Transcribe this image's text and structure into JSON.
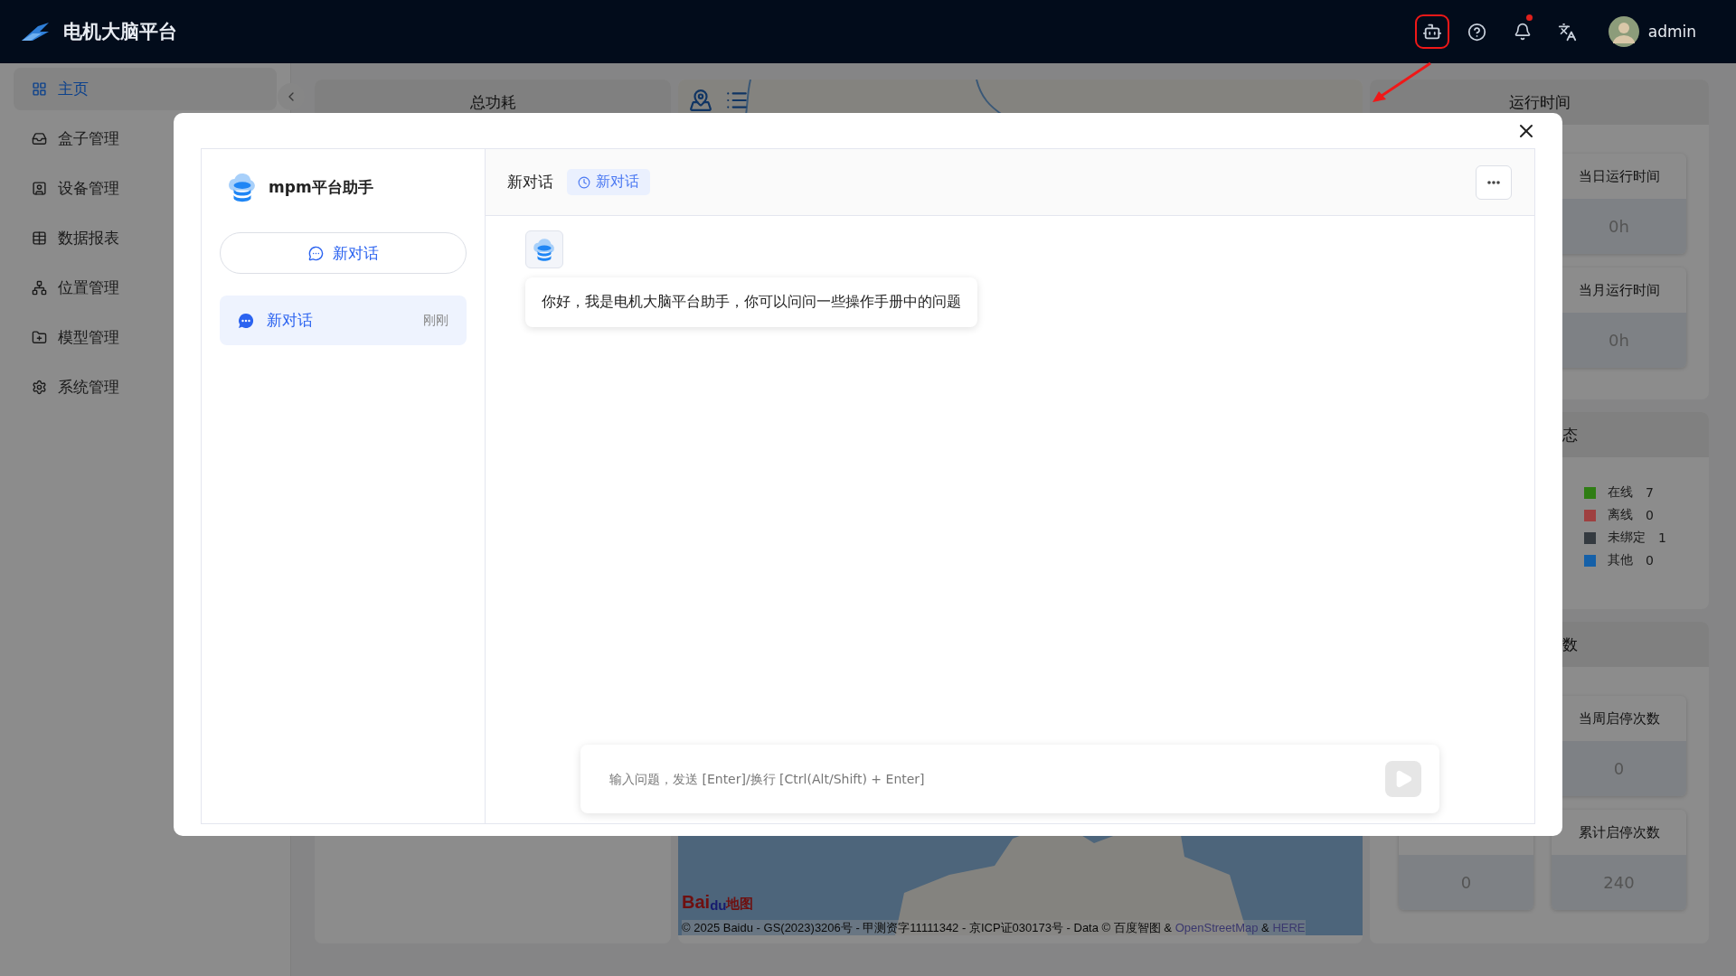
{
  "header": {
    "title": "电机大脑平台",
    "user": "admin",
    "assistant_highlighted": true,
    "has_unread": true
  },
  "sidebar": {
    "items": [
      {
        "label": "主页",
        "selected": true
      },
      {
        "label": "盒子管理",
        "selected": false
      },
      {
        "label": "设备管理",
        "selected": false
      },
      {
        "label": "数据报表",
        "selected": false
      },
      {
        "label": "位置管理",
        "selected": false
      },
      {
        "label": "模型管理",
        "selected": false
      },
      {
        "label": "系统管理",
        "selected": false
      }
    ]
  },
  "dashboard": {
    "power": {
      "title": "总功耗"
    },
    "map": {
      "logo": {
        "left": "Bai",
        "paw": "du",
        "right": "地图"
      },
      "attribution": "© 2025 Baidu - GS(2023)3206号 - 甲测资字11111342 - 京ICP证030173号 - Data © 百度智图 &",
      "links": [
        "OpenStreetMap",
        "HERE"
      ],
      "link_separator": "&"
    },
    "runtime": {
      "title": "运行时间",
      "cards": [
        {
          "title": "当日运行时间",
          "value": "0h"
        },
        {
          "title": "当月运行时间",
          "value": "0h"
        }
      ]
    },
    "status": {
      "title": "态",
      "legend": [
        {
          "label": "在线",
          "count": "7",
          "color": "#2f7d14"
        },
        {
          "label": "离线",
          "count": "0",
          "color": "#9f4040"
        },
        {
          "label": "未绑定",
          "count": "1",
          "color": "#343a40"
        },
        {
          "label": "其他",
          "count": "0",
          "color": "#1560a8"
        }
      ]
    },
    "startstop": {
      "title": "数",
      "cards": [
        {
          "title": "当周启停次数",
          "value": "0"
        },
        {
          "value": "0"
        },
        {
          "title": "累计启停次数",
          "value": "240"
        }
      ]
    }
  },
  "assistant": {
    "name": "mpm平台助手",
    "new_chat_button": "新对话",
    "conversations": [
      {
        "title": "新对话",
        "time": "刚刚",
        "selected": true
      }
    ],
    "chat_title": "新对话",
    "chat_tag": "新对话",
    "messages": [
      {
        "text": "你好，我是电机大脑平台助手，你可以问问一些操作手册中的问题"
      }
    ],
    "input": {
      "placeholder": "输入问题，发送 [Enter]/换行 [Ctrl(Alt/Shift) + Enter]"
    }
  }
}
